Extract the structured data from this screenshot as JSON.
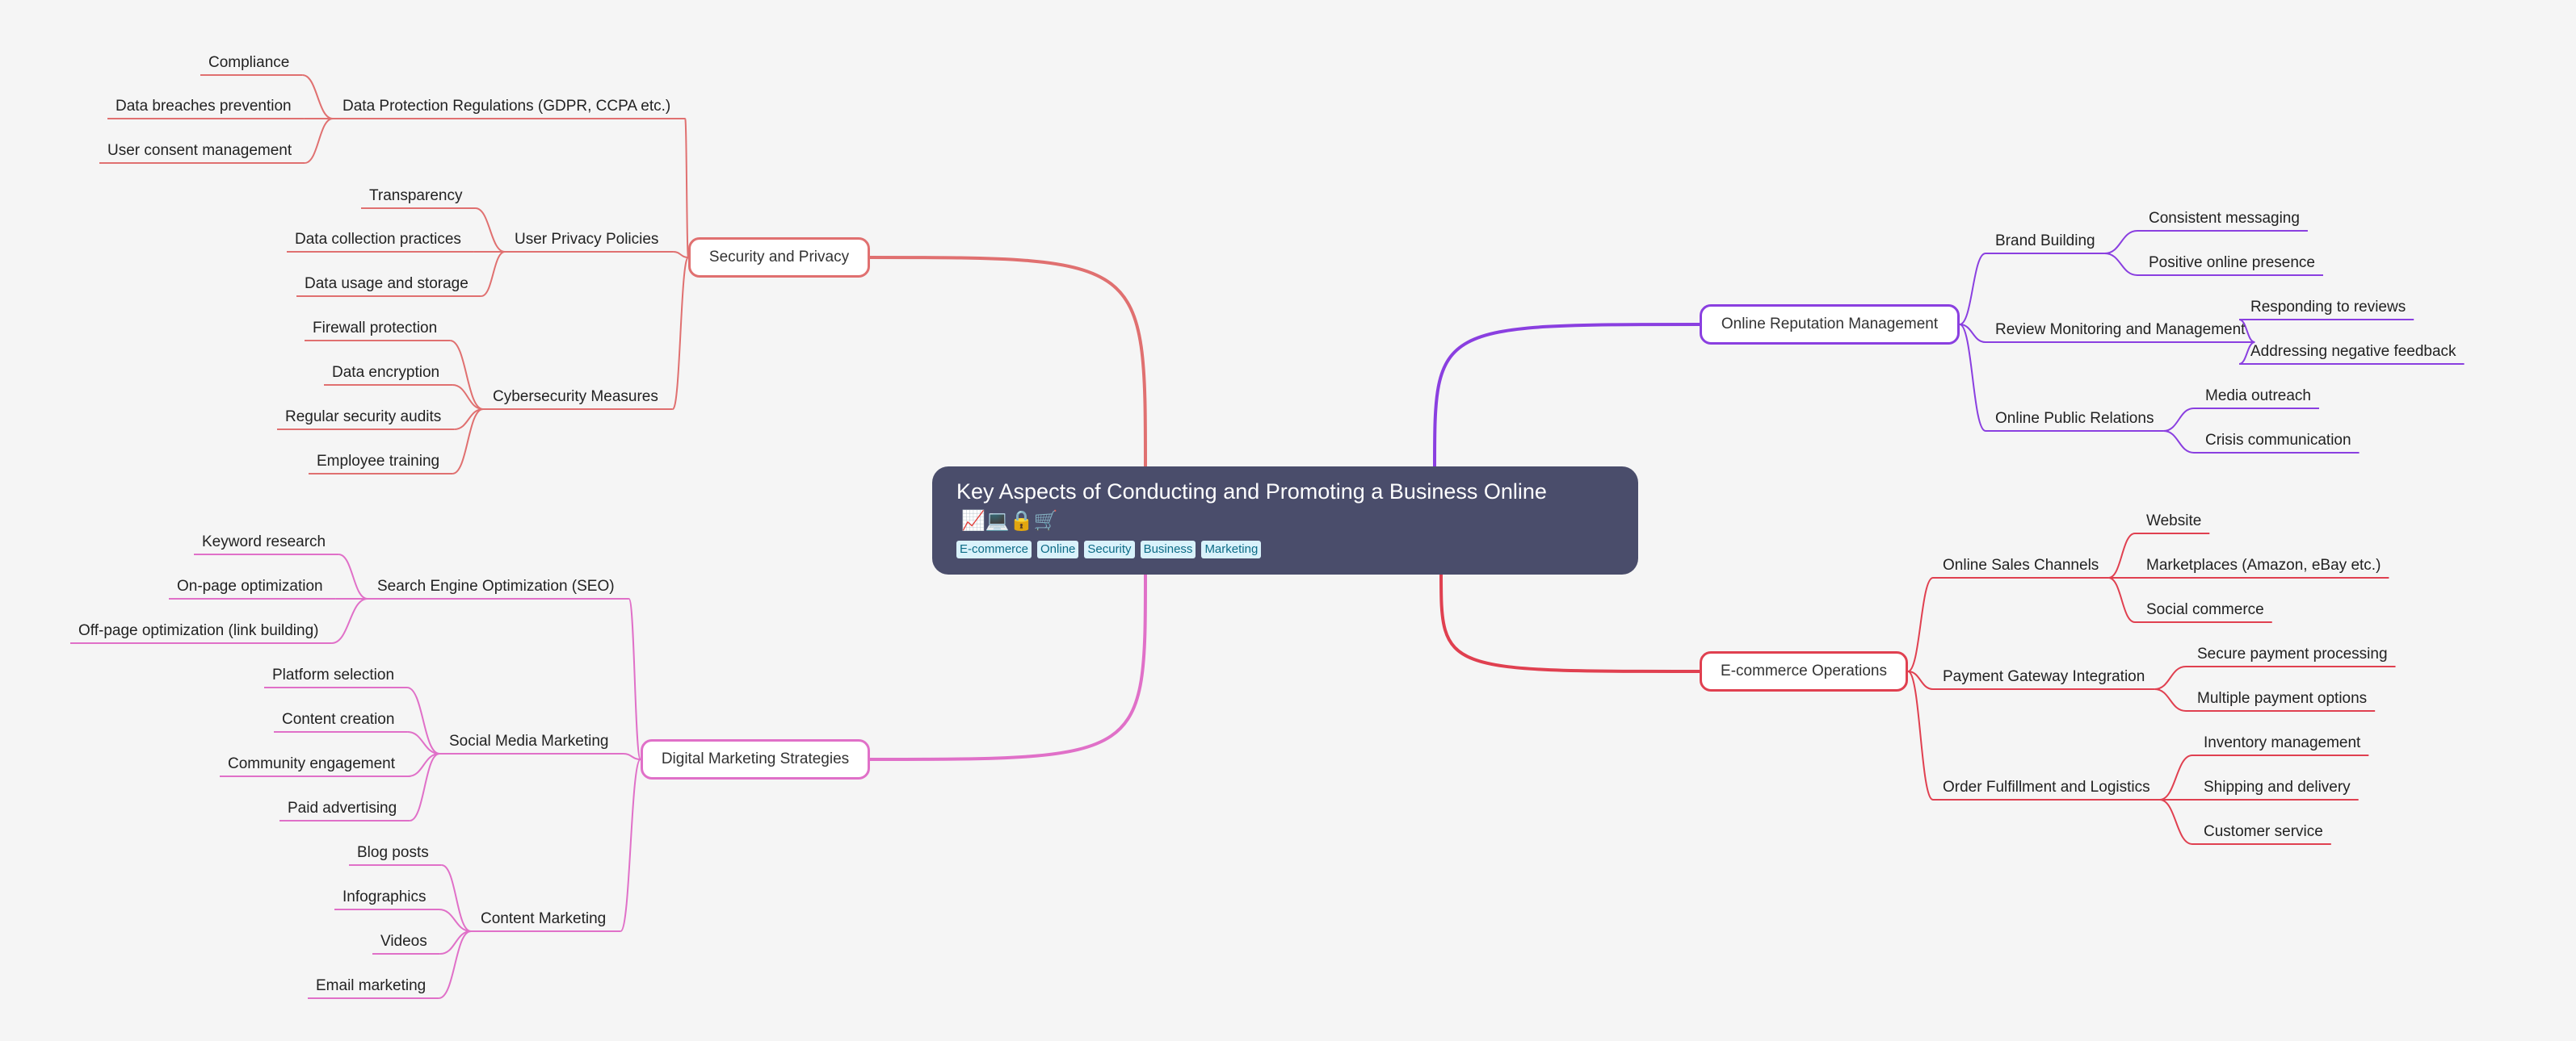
{
  "root": {
    "title": "Key Aspects of Conducting and Promoting a Business Online",
    "icons": "📈💻🔒🛒",
    "tags": [
      "E-commerce",
      "Online",
      "Security",
      "Business",
      "Marketing"
    ]
  },
  "colors": {
    "security": "#e07070",
    "marketing": "#e070c8",
    "reputation": "#8a3fe0",
    "ecommerce": "#e04050"
  },
  "branches": [
    {
      "label": "Security and Privacy",
      "children": [
        {
          "label": "Data Protection Regulations (GDPR, CCPA etc.)",
          "children": [
            "Compliance",
            "Data breaches prevention",
            "User consent management"
          ]
        },
        {
          "label": "User Privacy Policies",
          "children": [
            "Transparency",
            "Data collection practices",
            "Data usage and storage"
          ]
        },
        {
          "label": "Cybersecurity Measures",
          "children": [
            "Firewall protection",
            "Data encryption",
            "Regular security audits",
            "Employee training"
          ]
        }
      ]
    },
    {
      "label": "Digital Marketing Strategies",
      "children": [
        {
          "label": "Search Engine Optimization (SEO)",
          "children": [
            "Keyword research",
            "On-page optimization",
            "Off-page optimization (link building)"
          ]
        },
        {
          "label": "Social Media Marketing",
          "children": [
            "Platform selection",
            "Content creation",
            "Community engagement",
            "Paid advertising"
          ]
        },
        {
          "label": "Content Marketing",
          "children": [
            "Blog posts",
            "Infographics",
            "Videos",
            "Email marketing"
          ]
        }
      ]
    },
    {
      "label": "Online Reputation Management",
      "children": [
        {
          "label": "Brand Building",
          "children": [
            "Consistent messaging",
            "Positive online presence"
          ]
        },
        {
          "label": "Review Monitoring and Management",
          "children": [
            "Responding to reviews",
            "Addressing negative feedback"
          ]
        },
        {
          "label": "Online Public Relations",
          "children": [
            "Media outreach",
            "Crisis communication"
          ]
        }
      ]
    },
    {
      "label": "E-commerce Operations",
      "children": [
        {
          "label": "Online Sales Channels",
          "children": [
            "Website",
            "Marketplaces (Amazon, eBay etc.)",
            "Social commerce"
          ]
        },
        {
          "label": "Payment Gateway Integration",
          "children": [
            "Secure payment processing",
            "Multiple payment options"
          ]
        },
        {
          "label": "Order Fulfillment and Logistics",
          "children": [
            "Inventory management",
            "Shipping and delivery",
            "Customer service"
          ]
        }
      ]
    }
  ]
}
